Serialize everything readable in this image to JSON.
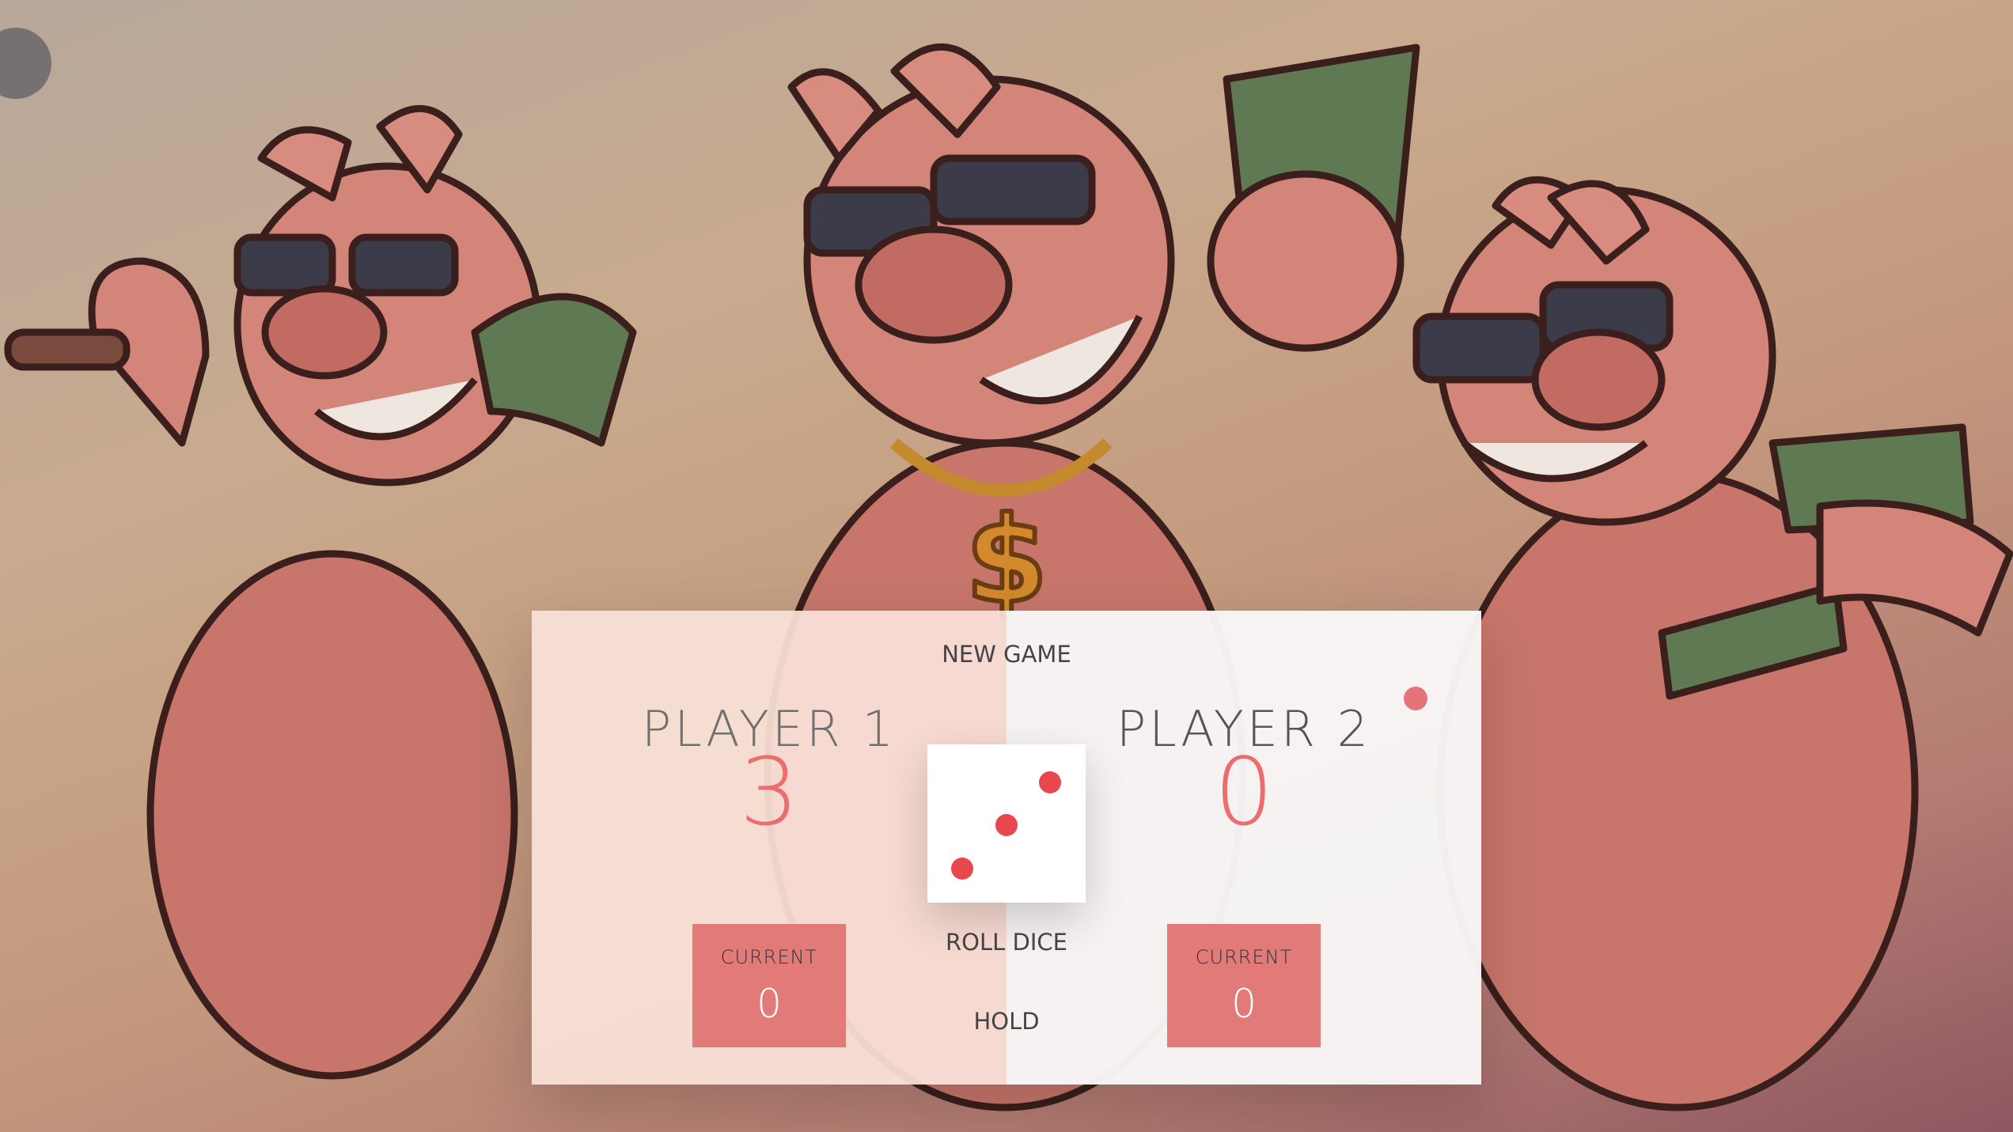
{
  "players": [
    {
      "name": "PLAYER 1",
      "score": "3",
      "current_label": "CURRENT",
      "current_score": "0",
      "active": false
    },
    {
      "name": "PLAYER 2",
      "score": "0",
      "current_label": "CURRENT",
      "current_score": "0",
      "active": true
    }
  ],
  "controls": {
    "new_game": "NEW GAME",
    "roll_dice": "ROLL DICE",
    "hold": "HOLD"
  },
  "dice": {
    "value": 3
  },
  "colors": {
    "accent": "#e17a79",
    "score": "#eb6d6d",
    "pip": "#e8474e",
    "player1_bg": "#fae2d8",
    "player2_bg": "#f8f7f7"
  },
  "background": {
    "icon": "cartoon-pigs-with-money-illustration"
  }
}
